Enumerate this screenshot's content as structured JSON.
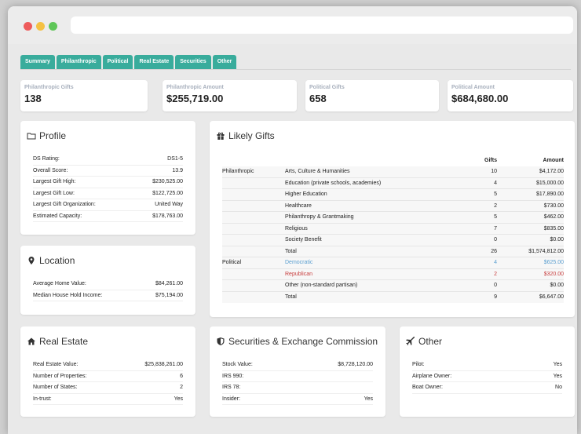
{
  "tabs": [
    "Summary",
    "Philanthropic",
    "Political",
    "Real Estate",
    "Securities",
    "Other"
  ],
  "stats": [
    {
      "label": "Philanthropic Gifts",
      "value": "138"
    },
    {
      "label": "Philanthropic Amount",
      "value": "$255,719.00"
    },
    {
      "label": "Political Gifts",
      "value": "658"
    },
    {
      "label": "Political Amount",
      "value": "$684,680.00"
    }
  ],
  "profile": {
    "title": "Profile",
    "rows": [
      {
        "k": "DS Rating:",
        "v": "DS1-5"
      },
      {
        "k": "Overall Score:",
        "v": "13.9"
      },
      {
        "k": "Largest Gift High:",
        "v": "$230,525.00"
      },
      {
        "k": "Largest Gift Low:",
        "v": "$122,725.00"
      },
      {
        "k": "Largest Gift Organization:",
        "v": "United Way"
      },
      {
        "k": "Estimated Capacity:",
        "v": "$178,763.00"
      }
    ]
  },
  "location": {
    "title": "Location",
    "rows": [
      {
        "k": "Average Home Value:",
        "v": "$84,261.00"
      },
      {
        "k": "Median House Hold Income:",
        "v": "$75,194.00"
      }
    ]
  },
  "likely": {
    "title": "Likely Gifts",
    "headers": {
      "gifts": "Gifts",
      "amount": "Amount"
    },
    "rows": [
      {
        "group": "Philanthropic",
        "cat": "Arts, Culture & Humanities",
        "gifts": "10",
        "amount": "$4,172.00"
      },
      {
        "group": "",
        "cat": "Education (private schools, academies)",
        "gifts": "4",
        "amount": "$15,000.00"
      },
      {
        "group": "",
        "cat": "Higher Education",
        "gifts": "5",
        "amount": "$17,890.00"
      },
      {
        "group": "",
        "cat": "Healthcare",
        "gifts": "2",
        "amount": "$730.00"
      },
      {
        "group": "",
        "cat": "Philanthropy & Grantmaking",
        "gifts": "5",
        "amount": "$462.00"
      },
      {
        "group": "",
        "cat": "Religious",
        "gifts": "7",
        "amount": "$835.00"
      },
      {
        "group": "",
        "cat": "Society Benefit",
        "gifts": "0",
        "amount": "$0.00"
      },
      {
        "group": "",
        "cat": "Total",
        "gifts": "26",
        "amount": "$1,574,812.00"
      },
      {
        "group": "Political",
        "cat": "Democratic",
        "gifts": "4",
        "amount": "$625.00"
      },
      {
        "group": "",
        "cat": "Republican",
        "gifts": "2",
        "amount": "$320.00"
      },
      {
        "group": "",
        "cat": "Other (non-standard partisan)",
        "gifts": "0",
        "amount": "$0.00"
      },
      {
        "group": "",
        "cat": "Total",
        "gifts": "9",
        "amount": "$6,647.00"
      }
    ]
  },
  "realestate": {
    "title": "Real Estate",
    "rows": [
      {
        "k": "Real Estate Value:",
        "v": "$25,838,261.00"
      },
      {
        "k": "Number of Properties:",
        "v": "6"
      },
      {
        "k": "Number of States:",
        "v": "2"
      },
      {
        "k": "In-trust:",
        "v": "Yes"
      }
    ]
  },
  "sec": {
    "title": "Securities & Exchange Commission",
    "rows": [
      {
        "k": "Stock Value:",
        "v": "$8,728,120.00"
      },
      {
        "k": "IRS 990:",
        "v": ""
      },
      {
        "k": "IRS 78:",
        "v": ""
      },
      {
        "k": "Insider:",
        "v": "Yes"
      }
    ]
  },
  "other": {
    "title": "Other",
    "rows": [
      {
        "k": "Pilot:",
        "v": "Yes"
      },
      {
        "k": "Airplane Owner:",
        "v": "Yes"
      },
      {
        "k": "Boat Owner:",
        "v": "No"
      }
    ]
  },
  "colors": {
    "tab": "#39ac9c",
    "democratic": "#5b9fd0",
    "republican": "#c83f3f"
  }
}
